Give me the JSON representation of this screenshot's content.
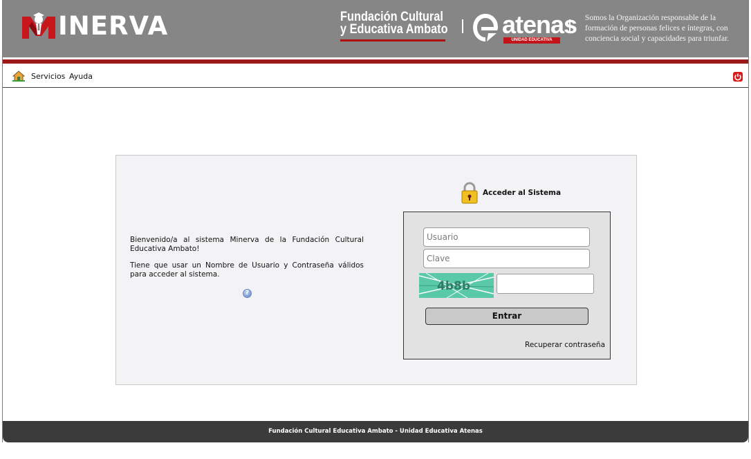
{
  "header": {
    "logo_text": "INERVA",
    "foundation_line1": "Fundación Cultural",
    "foundation_line2": "y Educativa Ambato",
    "atenas_word": "atenas",
    "atenas_badge": "UNIDAD EDUCATIVA",
    "tagline": "Somos la Organización responsable de la formación de personas felices e íntegras, con conciencia social y capacidades para triunfar.",
    "colors": {
      "header_bg": "#868686",
      "accent_red": "#9c1a1a"
    }
  },
  "menu": {
    "home_icon": "home-icon",
    "items": [
      {
        "label": "Servicios"
      },
      {
        "label": "Ayuda"
      }
    ],
    "logout_icon": "power-icon"
  },
  "welcome": {
    "paragraph1": "Bienvenido/a al sistema Minerva de la Fundación Cultural Educativa Ambato!",
    "paragraph2": "Tiene que usar un Nombre de Usuario y Contraseña válidos para acceder al sistema.",
    "help_icon": "help-icon"
  },
  "login": {
    "title": "Acceder al Sistema",
    "username_placeholder": "Usuario",
    "password_placeholder": "Clave",
    "captcha_text": "4b8b",
    "submit_label": "Entrar",
    "recover_label": "Recuperar contraseña"
  },
  "footer": {
    "text": "Fundación Cultural Educativa Ambato - Unidad Educativa Atenas"
  }
}
